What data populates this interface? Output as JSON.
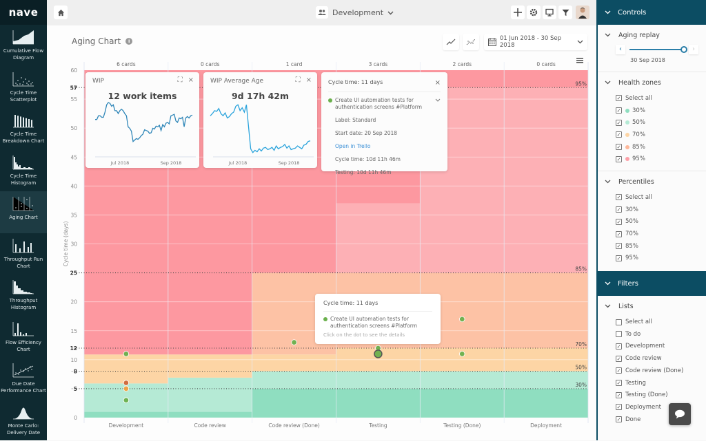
{
  "app": {
    "logo": "nave"
  },
  "sidebar": {
    "items": [
      {
        "label": "Cumulative Flow Diagram",
        "icon": "cfd-icon",
        "active": false
      },
      {
        "label": "Cycle Time Scatterplot",
        "icon": "scatterplot-icon",
        "active": false
      },
      {
        "label": "Cycle Time Breakdown Chart",
        "icon": "breakdown-icon",
        "active": false
      },
      {
        "label": "Cycle Time Histogram",
        "icon": "histogram-icon",
        "active": false
      },
      {
        "label": "Aging Chart",
        "icon": "aging-icon",
        "active": true
      },
      {
        "label": "Throughput Run Chart",
        "icon": "run-chart-icon",
        "active": false
      },
      {
        "label": "Throughput Histogram",
        "icon": "throughput-histogram-icon",
        "active": false
      },
      {
        "label": "Flow Efficiency Chart",
        "icon": "flow-efficiency-icon",
        "active": false
      },
      {
        "label": "Due Date Performance Chart",
        "icon": "due-date-icon",
        "active": false
      },
      {
        "label": "Monte Carlo: Delivery Date",
        "icon": "monte-carlo-icon",
        "active": false
      }
    ]
  },
  "topbar": {
    "board": "Development",
    "board_chevron": "⌄",
    "icons": [
      "home-icon",
      "board-users-icon",
      "add-icon",
      "gear-icon",
      "monitor-icon",
      "filter-icon",
      "avatar"
    ]
  },
  "page": {
    "title": "Aging Chart",
    "info": "i",
    "date_range": "01 Jun 2018 - 30 Sep 2018",
    "date_chevron": "⌄"
  },
  "wip_card": {
    "title": "WIP",
    "value": "12 work items",
    "x_ticks": [
      "Jul 2018",
      "Sep 2018"
    ]
  },
  "age_card": {
    "title": "WIP Average Age",
    "value": "9d 17h 42m",
    "x_ticks": [
      "Jul 2018",
      "Sep 2018"
    ]
  },
  "detail_tooltip": {
    "title": "Cycle time: 11 days",
    "item": "Create UI automation tests for authentication screens #Platform",
    "label": "Label: Standard",
    "start": "Start date: 20 Sep 2018",
    "link": "Open in Trello",
    "cycle": "Cycle time: 10d 11h 46m",
    "stage": "Testing: 10d 11h 46m",
    "close": "×",
    "chevron": "⌄"
  },
  "hover_tooltip": {
    "title": "Cycle time: 11 days",
    "item": "Create UI automation tests for authentication screens #Platform",
    "hint": "Click on the dot to see the details"
  },
  "chart_data": {
    "type": "scatter",
    "title": "Aging Chart",
    "ylabel": "Cycle time (days)",
    "xlabel": "",
    "ylim": [
      0,
      60
    ],
    "y_ticks": [
      0,
      5,
      8,
      10,
      12,
      15,
      20,
      25,
      30,
      35,
      40,
      45,
      50,
      55,
      57,
      60
    ],
    "y_ticks_bold": [
      5,
      8,
      12,
      25,
      57
    ],
    "categories": [
      "Development",
      "Code review",
      "Code review (Done)",
      "Testing",
      "Testing (Done)",
      "Deployment"
    ],
    "card_counts": [
      "6 cards",
      "0 cards",
      "1 card",
      "3 cards",
      "2 cards",
      "0 cards"
    ],
    "percentile_lines": [
      {
        "label": "30%",
        "value": 5
      },
      {
        "label": "50%",
        "value": 8
      },
      {
        "label": "70%",
        "value": 12
      },
      {
        "label": "85%",
        "value": 25
      },
      {
        "label": "95%",
        "value": 57
      }
    ],
    "zone_colors": {
      "30": "#8fdec0",
      "50": "#b5ead5",
      "70": "#fdd5a5",
      "85": "#fdc2a5",
      "95": "#fdb0b5",
      "over": "#fd98a0"
    },
    "zones": [
      {
        "column": "Development",
        "bands": [
          [
            0,
            1,
            "30"
          ],
          [
            1,
            5.9,
            "50"
          ],
          [
            5.9,
            10.9,
            "70"
          ],
          [
            10.9,
            60,
            "over"
          ]
        ]
      },
      {
        "column": "Code review",
        "bands": [
          [
            0,
            1,
            "30"
          ],
          [
            1,
            6.9,
            "50"
          ],
          [
            6.9,
            10.9,
            "70"
          ],
          [
            10.9,
            60,
            "over"
          ]
        ]
      },
      {
        "column": "Code review (Done)",
        "bands": [
          [
            0,
            5,
            "30"
          ],
          [
            5,
            8,
            "50"
          ],
          [
            8,
            10.9,
            "70"
          ],
          [
            10.9,
            25,
            "85"
          ],
          [
            25,
            60,
            "over"
          ]
        ]
      },
      {
        "column": "Testing",
        "bands": [
          [
            0,
            5,
            "30"
          ],
          [
            5,
            8,
            "50"
          ],
          [
            8,
            12,
            "70"
          ],
          [
            12,
            25,
            "85"
          ],
          [
            25,
            37,
            "95"
          ],
          [
            37,
            60,
            "over"
          ]
        ]
      },
      {
        "column": "Testing (Done)",
        "bands": [
          [
            0,
            5,
            "30"
          ],
          [
            5,
            8,
            "50"
          ],
          [
            8,
            12,
            "70"
          ],
          [
            12,
            25,
            "85"
          ],
          [
            25,
            57,
            "95"
          ],
          [
            57,
            60,
            "over"
          ]
        ]
      },
      {
        "column": "Deployment",
        "bands": [
          [
            0,
            5,
            "30"
          ],
          [
            5,
            8,
            "50"
          ],
          [
            8,
            12,
            "70"
          ],
          [
            12,
            25,
            "85"
          ],
          [
            25,
            57,
            "95"
          ],
          [
            57,
            60,
            "over"
          ]
        ]
      }
    ],
    "points": [
      {
        "column": "Development",
        "value": 11,
        "color": "#6ab04c"
      },
      {
        "column": "Development",
        "value": 6,
        "color": "#d0673a"
      },
      {
        "column": "Development",
        "value": 5,
        "color": "#f0a040"
      },
      {
        "column": "Development",
        "value": 3,
        "color": "#6ab04c"
      },
      {
        "column": "Code review (Done)",
        "value": 13,
        "color": "#6ab04c"
      },
      {
        "column": "Testing",
        "value": 12,
        "color": "#6ab04c"
      },
      {
        "column": "Testing",
        "value": 11,
        "color": "#6ab04c",
        "selected": true
      },
      {
        "column": "Testing (Done)",
        "value": 17,
        "color": "#6ab04c"
      },
      {
        "column": "Testing (Done)",
        "value": 11,
        "color": "#6ab04c"
      }
    ],
    "grid": true
  },
  "controls": {
    "header": "Controls",
    "aging_replay": {
      "title": "Aging replay",
      "date": "30 Sep 2018",
      "prev": "‹",
      "next": "›",
      "position": 1.0
    },
    "health_zones": {
      "title": "Health zones",
      "items": [
        {
          "label": "Select all",
          "checked": true,
          "color": null
        },
        {
          "label": "30%",
          "checked": true,
          "color": "#8fdec0"
        },
        {
          "label": "50%",
          "checked": true,
          "color": "#b5ead5"
        },
        {
          "label": "70%",
          "checked": true,
          "color": "#fdd5a5"
        },
        {
          "label": "85%",
          "checked": true,
          "color": "#fdb89a"
        },
        {
          "label": "95%",
          "checked": true,
          "color": "#fda0a8"
        }
      ]
    },
    "percentiles": {
      "title": "Percentiles",
      "items": [
        {
          "label": "Select all",
          "checked": true
        },
        {
          "label": "30%",
          "checked": true
        },
        {
          "label": "50%",
          "checked": true
        },
        {
          "label": "70%",
          "checked": true
        },
        {
          "label": "85%",
          "checked": true
        },
        {
          "label": "95%",
          "checked": true
        }
      ]
    }
  },
  "filters": {
    "header": "Filters",
    "lists": {
      "title": "Lists",
      "items": [
        {
          "label": "Select all",
          "checked": false
        },
        {
          "label": "To do",
          "checked": false
        },
        {
          "label": "Development",
          "checked": true
        },
        {
          "label": "Code review",
          "checked": true
        },
        {
          "label": "Code review (Done)",
          "checked": true
        },
        {
          "label": "Testing",
          "checked": true
        },
        {
          "label": "Testing (Done)",
          "checked": true
        },
        {
          "label": "Deployment",
          "checked": true
        },
        {
          "label": "Done",
          "checked": true
        }
      ]
    }
  },
  "chevron": "⌄",
  "check": "✓",
  "close": "×"
}
